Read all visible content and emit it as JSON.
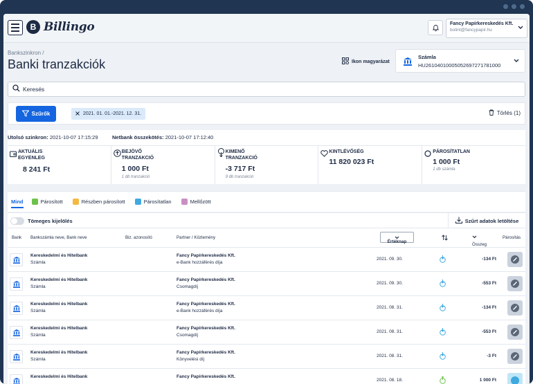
{
  "header": {
    "app_name": "Billingo",
    "logo_letter": "B",
    "company_name": "Fancy Papírkereskedés Kft.",
    "company_email": "bolint@fancypapir.hu"
  },
  "page": {
    "breadcrumb": "Bankszinkron",
    "title": "Banki tranzakciók",
    "legend_label": "Ikon magyarázat"
  },
  "account": {
    "label": "Számla",
    "number": "HU26104010005052697271781000"
  },
  "search": {
    "placeholder": "Keresés"
  },
  "filters": {
    "button_label": "Szűrők",
    "active_chip": "2021. 01. 01.-2021. 12. 31.",
    "clear_label": "Törlés (1)"
  },
  "sync": {
    "last_sync_label": "Utolsó szinkron:",
    "last_sync_value": "2021-10-07 17:15:29",
    "netbank_label": "Netbank összekötés:",
    "netbank_value": "2021-10-07 17:12:40"
  },
  "stats": [
    {
      "title_line1": "AKTUÁLIS",
      "title_line2": "EGYENLEG",
      "value": "8 241 Ft",
      "sub": ""
    },
    {
      "title_line1": "BEJÖVŐ",
      "title_line2": "TRANZAKCIÓ",
      "value": "1 000 Ft",
      "sub": "1 db tranzakció"
    },
    {
      "title_line1": "KIMENŐ",
      "title_line2": "TRANZAKCIÓ",
      "value": "-3 717 Ft",
      "sub": "9 db tranzakció"
    },
    {
      "title_line1": "KINTLÉVŐSÉG",
      "title_line2": "",
      "value": "11 820 023 Ft",
      "sub": ""
    },
    {
      "title_line1": "PÁROSÍTATLAN",
      "title_line2": "",
      "value": "1 000 Ft",
      "sub": "1 db számla"
    }
  ],
  "tabs": [
    {
      "label": "Mind",
      "color": ""
    },
    {
      "label": "Párosított",
      "color": "#6cc24a"
    },
    {
      "label": "Részben párosított",
      "color": "#f4b942"
    },
    {
      "label": "Párosítatlan",
      "color": "#3fa9e0"
    },
    {
      "label": "Mellőzött",
      "color": "#c98fc4"
    }
  ],
  "bulk": {
    "label": "Tömeges kijelölés",
    "download_label": "Szűrt adatok letöltése"
  },
  "table": {
    "headers": {
      "bank": "Bank",
      "account": "Bankszámla neve, Bank neve",
      "biz": "Biz. azonosító",
      "partner": "Partner / Közlemény",
      "date": "Értéknap",
      "amount": "Összeg",
      "pairing": "Párosítás"
    },
    "rows": [
      {
        "bank": "Kereskedelmi és Hitelbank",
        "account": "Számla",
        "partner": "Fancy Papírkereskedés Kft.",
        "memo": "e-Bank hozzáférés díja",
        "date": "2021. 09. 30.",
        "amount": "-134 Ft"
      },
      {
        "bank": "Kereskedelmi és Hitelbank",
        "account": "Számla",
        "partner": "Fancy Papírkereskedés Kft.",
        "memo": "Csomagdíj",
        "date": "2021. 09. 30.",
        "amount": "-553 Ft"
      },
      {
        "bank": "Kereskedelmi és Hitelbank",
        "account": "Számla",
        "partner": "Fancy Papírkereskedés Kft.",
        "memo": "e-Bank hozzáférés díja",
        "date": "2021. 08. 31.",
        "amount": "-134 Ft"
      },
      {
        "bank": "Kereskedelmi és Hitelbank",
        "account": "Számla",
        "partner": "Fancy Papírkereskedés Kft.",
        "memo": "Csomagdíj",
        "date": "2021. 08. 31.",
        "amount": "-553 Ft"
      },
      {
        "bank": "Kereskedelmi és Hitelbank",
        "account": "Számla",
        "partner": "Fancy Papírkereskedés Kft.",
        "memo": "Könyvelési díj",
        "date": "2021. 08. 31.",
        "amount": "-3 Ft"
      },
      {
        "bank": "Kereskedelmi és Hitelbank",
        "account": "",
        "partner": "Fancy Papírkereskedés Kft.",
        "memo": "",
        "date": "2021. 08. 18.",
        "amount": "1 000 Ft"
      }
    ]
  },
  "colors": {
    "primary": "#1565e0",
    "navy": "#1d2a44",
    "frame": "#1f3552"
  },
  "icons": [
    "menu-icon",
    "bell-icon",
    "chevron-down-icon",
    "legend-icon",
    "bank-icon",
    "search-icon",
    "filter-icon",
    "close-icon",
    "trash-icon",
    "wallet-icon",
    "arrow-up-icon",
    "arrow-down-icon",
    "heart-icon",
    "circle-icon",
    "download-icon",
    "sort-icon",
    "pair-icon"
  ]
}
